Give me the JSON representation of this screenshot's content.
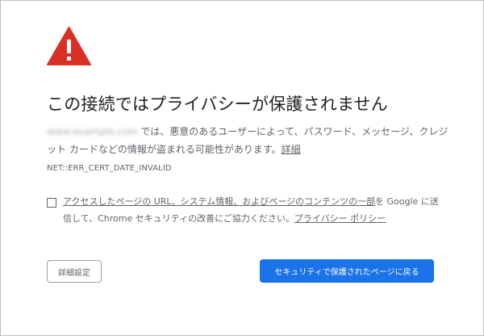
{
  "icon": {
    "name": "warning-triangle-icon",
    "color": "#d93025"
  },
  "heading": "この接続ではプライバシーが保護されません",
  "description": {
    "hostname": "www.example.com",
    "text": "では、悪意のあるユーザーによって、パスワード、メッセージ、クレジット カードなどの情報が盗まれる可能性があります。",
    "details_link": "詳細"
  },
  "error_code": "NET::ERR_CERT_DATE_INVALID",
  "optin": {
    "checked": false,
    "text_underlined": "アクセスしたページの URL、システム情報、およびページのコンテンツの一部",
    "text_rest": "を Google に送信して、Chrome セキュリティの改善にご協力ください。",
    "privacy_link": "プライバシー ポリシー"
  },
  "buttons": {
    "advanced_label": "詳細設定",
    "back_label": "セキュリティで保護されたページに戻る"
  },
  "colors": {
    "primary_button": "#1a73e8",
    "warning": "#d93025",
    "text_secondary": "#5f6368"
  }
}
